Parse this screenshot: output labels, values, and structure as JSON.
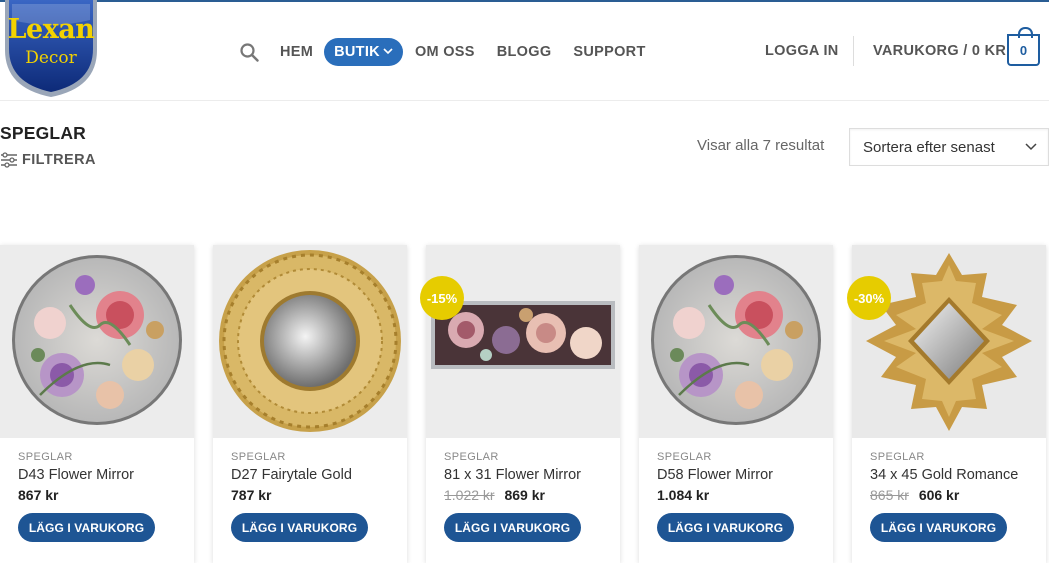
{
  "logo": {
    "line1": "Lexan",
    "line2": "Decor"
  },
  "nav": {
    "items": [
      {
        "label": "HEM"
      },
      {
        "label": "BUTIK"
      },
      {
        "label": "OM OSS"
      },
      {
        "label": "BLOGG"
      },
      {
        "label": "SUPPORT"
      }
    ],
    "login": "LOGGA IN",
    "cart_label": "VARUKORG / 0 KR",
    "cart_count": "0"
  },
  "page": {
    "title": "SPEGLAR",
    "filter": "FILTRERA",
    "results": "Visar alla 7 resultat",
    "sort": "Sortera efter senast"
  },
  "products": [
    {
      "category": "SPEGLAR",
      "name": "D43 Flower Mirror",
      "old_price": "",
      "price": "867 kr",
      "button": "LÄGG I VARUKORG",
      "badge": ""
    },
    {
      "category": "SPEGLAR",
      "name": "D27 Fairytale Gold",
      "old_price": "",
      "price": "787 kr",
      "button": "LÄGG I VARUKORG",
      "badge": ""
    },
    {
      "category": "SPEGLAR",
      "name": "81 x 31 Flower Mirror",
      "old_price": "1.022 kr",
      "price": "869 kr",
      "button": "LÄGG I VARUKORG",
      "badge": "-15%"
    },
    {
      "category": "SPEGLAR",
      "name": "D58 Flower Mirror",
      "old_price": "",
      "price": "1.084 kr",
      "button": "LÄGG I VARUKORG",
      "badge": ""
    },
    {
      "category": "SPEGLAR",
      "name": "34 x 45 Gold Romance",
      "old_price": "865 kr",
      "price": "606 kr",
      "button": "LÄGG I VARUKORG",
      "badge": "-30%"
    }
  ],
  "colors": {
    "accent": "#2a6ebb",
    "button": "#1e5594",
    "badge": "#e6cc00",
    "cart": "#1e5da0"
  }
}
